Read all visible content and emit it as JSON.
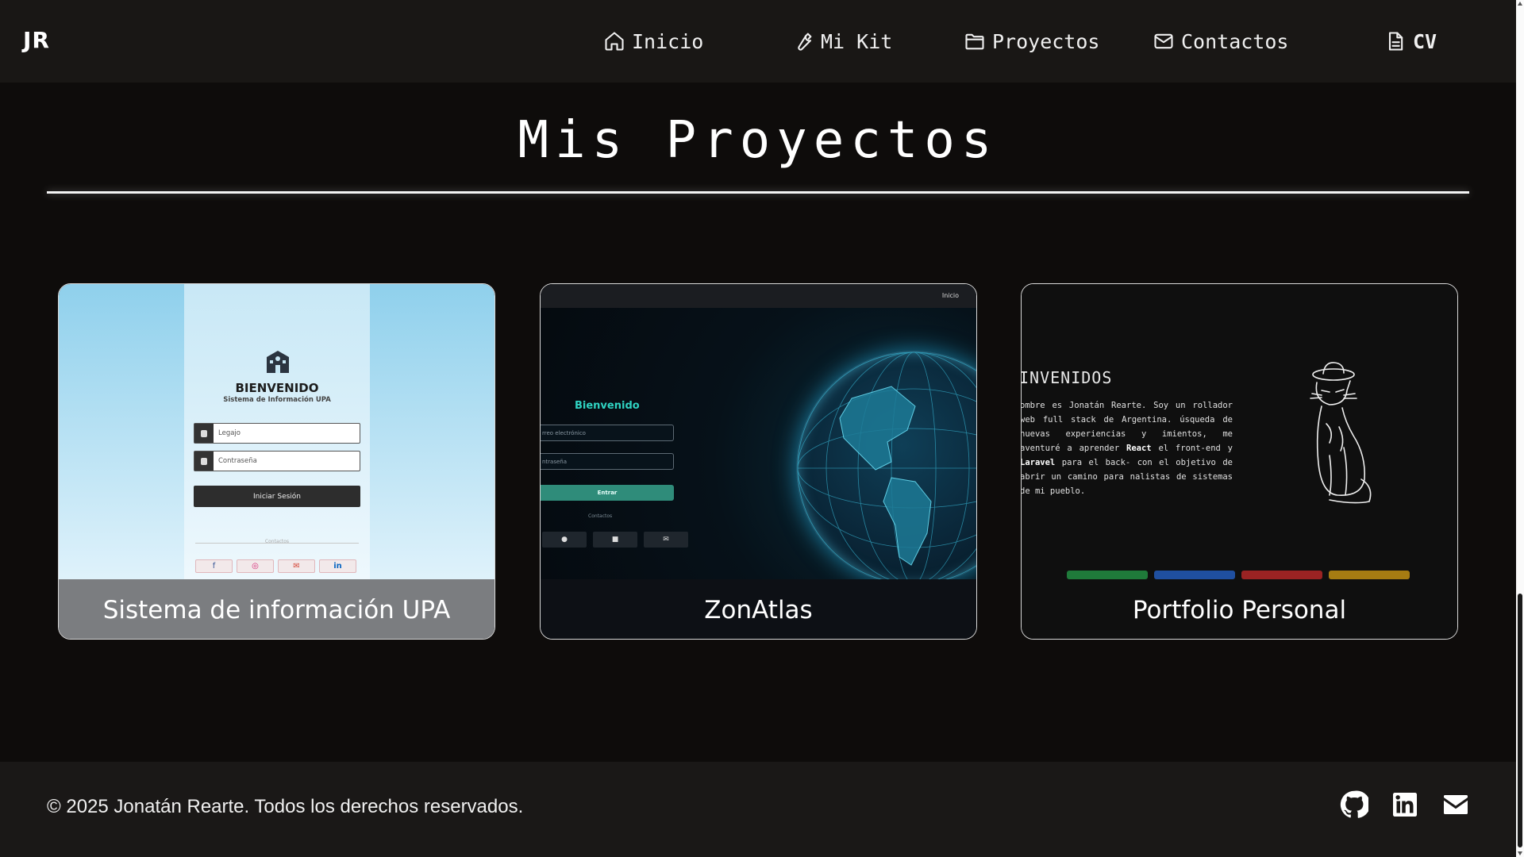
{
  "navbar": {
    "logo": "JR",
    "items": [
      {
        "label": "Inicio",
        "icon": "home-icon"
      },
      {
        "label": "Mi Kit",
        "icon": "wrench-icon"
      },
      {
        "label": "Proyectos",
        "icon": "folder-icon"
      },
      {
        "label": "Contactos",
        "icon": "mail-icon"
      },
      {
        "label": "CV",
        "icon": "document-icon"
      }
    ]
  },
  "main": {
    "title": "Mis Proyectos",
    "projects": [
      {
        "title": "Sistema de información UPA",
        "preview": {
          "welcome": "BIENVENIDO",
          "subtitle": "Sistema de Información UPA",
          "field_user": "Legajo",
          "field_password": "Contraseña",
          "button": "Iniciar Sesión",
          "contact": "Contactos"
        }
      },
      {
        "title": "ZonAtlas",
        "preview": {
          "nav": "Inicio",
          "welcome": "Bienvenido",
          "field_email": "rreo electrónico",
          "field_password": "ntraseña",
          "button": "Entrar",
          "contact": "Contactos"
        }
      },
      {
        "title": "Portfolio Personal",
        "preview": {
          "heading": "INVENIDOS",
          "text_before_react": "ombre es Jonatán Rearte. Soy un rollador web full stack de Argentina. úsqueda de nuevas experiencias y imientos, me aventuré a aprender ",
          "react": "React",
          "text_between": " el front-end y ",
          "laravel": "Laravel",
          "text_after": " para el back- con el objetivo de abrir un camino para nalistas de sistemas de mi pueblo."
        }
      }
    ]
  },
  "footer": {
    "copyright": "© 2025 Jonatán Rearte. Todos los derechos reservados.",
    "socials": [
      "github-icon",
      "linkedin-icon",
      "mail-icon"
    ]
  },
  "colors": {
    "background": "#0e0c0b",
    "navbar": "#191715",
    "footer": "#1a1817",
    "zonatlas_accent": "#2fd3c2",
    "bar_green": "#1f7a3a",
    "bar_blue": "#1f4fa0",
    "bar_red": "#9b2323",
    "bar_yellow": "#a67c12"
  }
}
